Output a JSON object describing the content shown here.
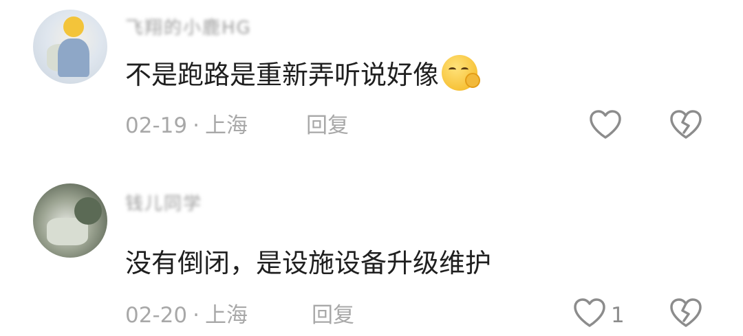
{
  "comments": [
    {
      "username": "飞翔的小鹿HG",
      "text": "不是跑路是重新弄听说好像",
      "emoji": "shushing-face-emoji",
      "date": "02-19",
      "separator": "·",
      "location": "上海",
      "reply_label": "回复",
      "like_count": ""
    },
    {
      "username": "钱儿同学",
      "text": "没有倒闭，是设施设备升级维护",
      "date": "02-20",
      "separator": "·",
      "location": "上海",
      "reply_label": "回复",
      "like_count": "1"
    }
  ],
  "colors": {
    "text": "#1f1f1f",
    "meta": "#a8a8a8",
    "icon": "#8c8c8c"
  }
}
